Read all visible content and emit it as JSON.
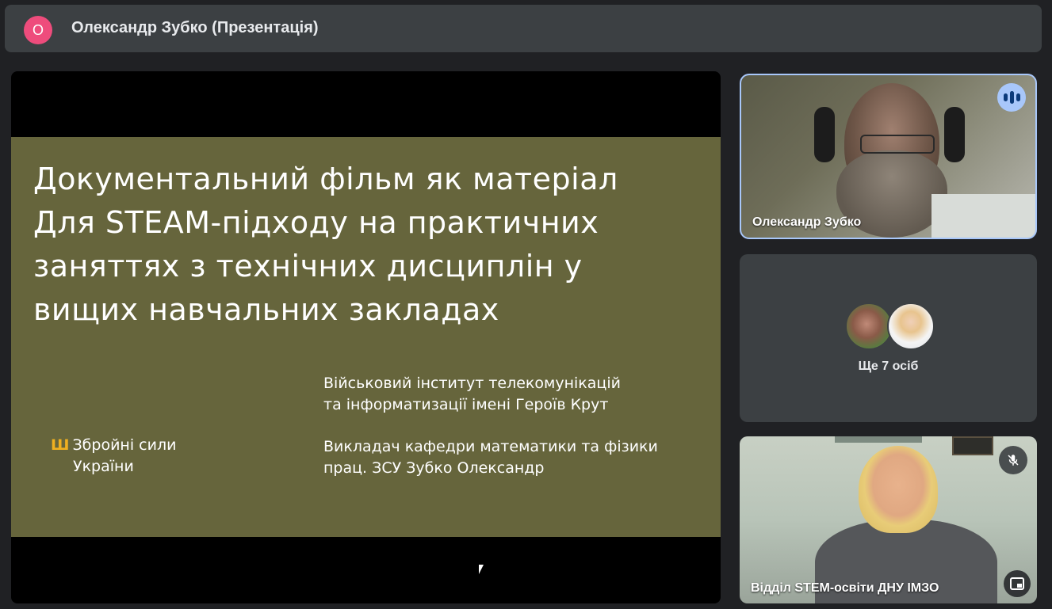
{
  "header": {
    "avatar_letter": "О",
    "title": "Олександр Зубко (Презентація)",
    "avatar_color": "#ee4c7c"
  },
  "slide": {
    "title_lines": [
      "Документальний фільм як матеріал",
      "Для STEAM-підходу на практичних",
      "заняттях з технічних дисциплін у",
      "вищих навчальних закладах"
    ],
    "institute_lines": [
      "Військовий інститут телекомунікацій",
      "та інформатизації імені Героїв Крут"
    ],
    "teacher_lines": [
      "Викладач кафедри математики та фізики",
      "прац. ЗСУ Зубко Олександр"
    ],
    "org_lines": [
      "Збройні сили",
      "України"
    ],
    "background_color": "#66653c"
  },
  "participants": {
    "tile1": {
      "name": "Олександр Зубко",
      "speaking_icon": "speaking-indicator-icon"
    },
    "tile2": {
      "more_label": "Ще 7 осіб"
    },
    "tile3": {
      "name": "Відділ STEM-освіти ДНУ ІМЗО",
      "mute_icon": "mic-off-icon",
      "pip_icon": "picture-in-picture-icon"
    }
  },
  "colors": {
    "accent": "#a8c7fa",
    "background": "#202124",
    "surface": "#3c4043"
  }
}
